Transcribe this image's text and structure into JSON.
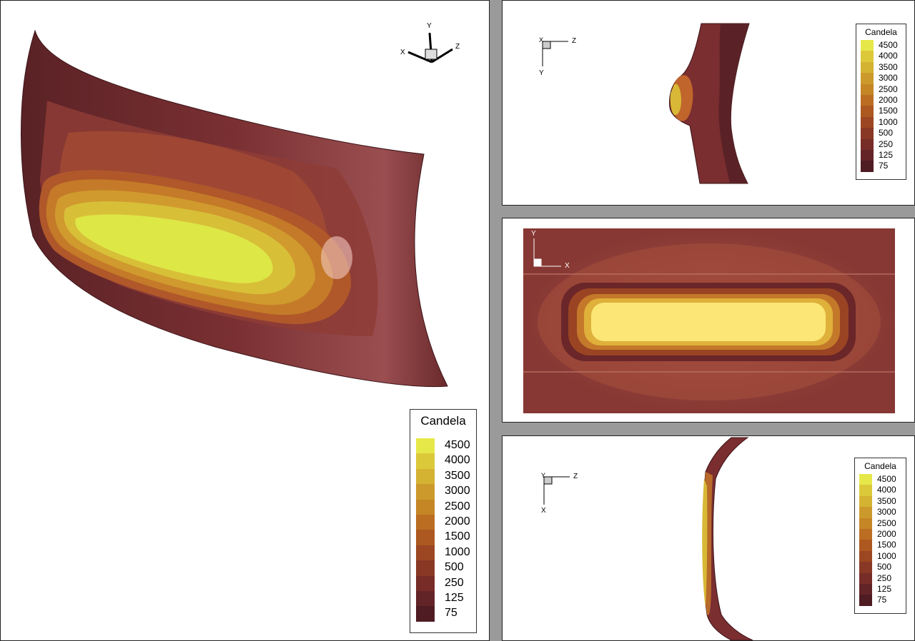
{
  "legend": {
    "title": "Candela",
    "levels": [
      "4500",
      "4000",
      "3500",
      "3000",
      "2500",
      "2000",
      "1500",
      "1000",
      "500",
      "250",
      "125",
      "75"
    ],
    "colors": [
      "#e6e84a",
      "#dcc93a",
      "#d4b232",
      "#cc9a2c",
      "#c58626",
      "#bb6e22",
      "#ad5820",
      "#9c4722",
      "#893826",
      "#772c28",
      "#632428",
      "#4e1c22"
    ]
  },
  "views": {
    "main": {
      "axes": {
        "x": "X",
        "y": "Y",
        "z": "Z"
      }
    },
    "top": {
      "axes": {
        "h": "Z",
        "v": "Y",
        "corner": "X"
      }
    },
    "mid": {
      "axes": {
        "h": "X",
        "v": "Y"
      }
    },
    "bot": {
      "axes": {
        "h": "Z",
        "v": "X",
        "corner": "Y"
      }
    }
  }
}
